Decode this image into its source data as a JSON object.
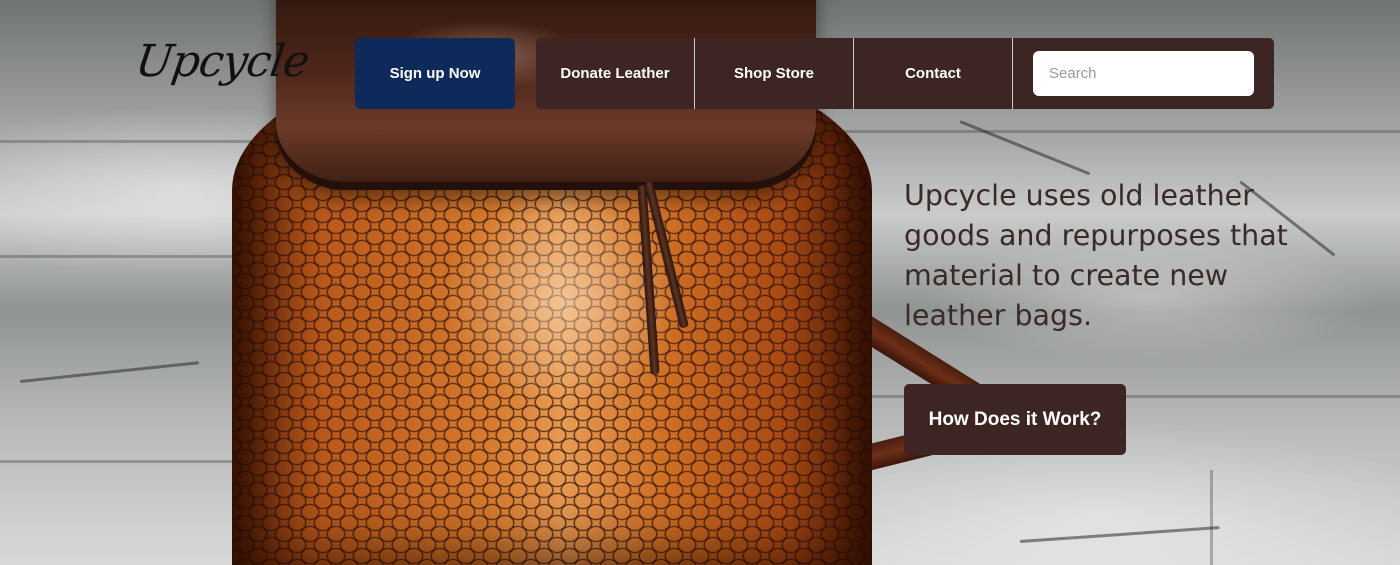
{
  "brand": {
    "logo_text": "Upcycle"
  },
  "header": {
    "signup_label": "Sign up Now",
    "nav": [
      {
        "label": "Donate Leather"
      },
      {
        "label": "Shop Store"
      },
      {
        "label": "Contact"
      }
    ],
    "search": {
      "placeholder": "Search",
      "value": ""
    }
  },
  "hero": {
    "tagline": "Upcycle uses old leather goods and repurposes that material to create new leather bags.",
    "cta_label": "How Does it Work?"
  },
  "colors": {
    "signup_bg": "#0d2a5a",
    "nav_bg": "#3c2523",
    "cta_bg": "#3c2523",
    "hero_text": "#3a2a28"
  }
}
